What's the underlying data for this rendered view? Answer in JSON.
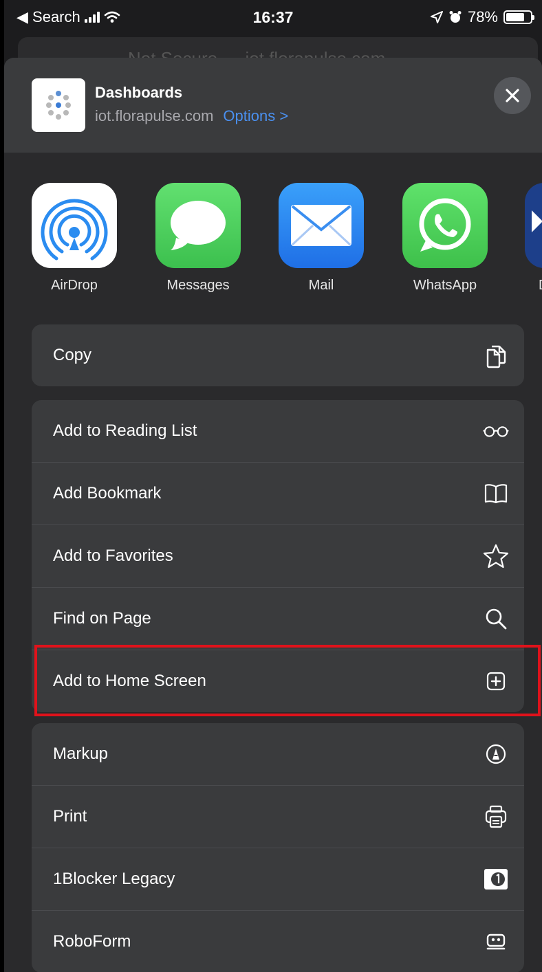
{
  "status_bar": {
    "back_label": "◀ Search",
    "time": "16:37",
    "battery": "78%",
    "battery_level": 0.78
  },
  "background_url_bar": {
    "text": "Not Secure — iot.florapulse.com"
  },
  "share_header": {
    "title": "Dashboards",
    "domain": "iot.florapulse.com",
    "options_label": "Options >"
  },
  "apps": [
    {
      "label": "AirDrop",
      "icon": "airdrop-icon",
      "color": "#ffffff"
    },
    {
      "label": "Messages",
      "icon": "messages-icon",
      "color": "#4cd964"
    },
    {
      "label": "Mail",
      "icon": "mail-icon",
      "color": "#2e8cf4"
    },
    {
      "label": "WhatsApp",
      "icon": "whatsapp-icon",
      "color": "#4ccf5a"
    },
    {
      "label": "D",
      "icon": "partial-app-icon",
      "color": "#1d3f8a"
    }
  ],
  "actions": {
    "copy": {
      "label": "Copy",
      "icon": "copy-icon"
    },
    "reading_list": {
      "label": "Add to Reading List",
      "icon": "glasses-icon"
    },
    "bookmark": {
      "label": "Add Bookmark",
      "icon": "book-icon"
    },
    "favorites": {
      "label": "Add to Favorites",
      "icon": "star-icon"
    },
    "find": {
      "label": "Find on Page",
      "icon": "search-icon"
    },
    "home_screen": {
      "label": "Add to Home Screen",
      "icon": "plus-square-icon"
    },
    "markup": {
      "label": "Markup",
      "icon": "markup-icon"
    },
    "print": {
      "label": "Print",
      "icon": "printer-icon"
    },
    "oneblocker": {
      "label": "1Blocker Legacy",
      "icon": "oneblocker-icon"
    },
    "roboform": {
      "label": "RoboForm",
      "icon": "roboform-icon"
    }
  },
  "colors": {
    "highlight": "#e0121b",
    "link": "#4a90f0"
  }
}
